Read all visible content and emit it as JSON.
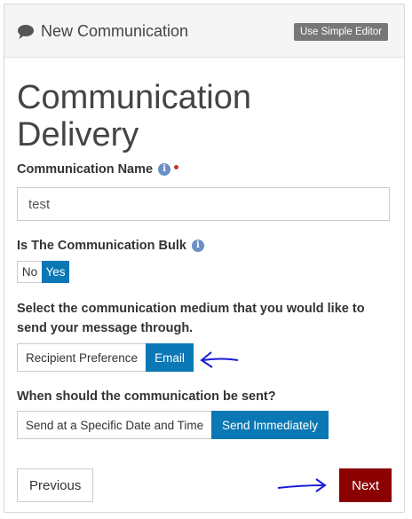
{
  "header": {
    "title": "New Communication",
    "simple_editor_label": "Use Simple Editor"
  },
  "page_title": "Communication Delivery",
  "communication_name": {
    "label": "Communication Name",
    "value": "test"
  },
  "bulk": {
    "label": "Is The Communication Bulk",
    "options": [
      "No",
      "Yes"
    ],
    "selected": "Yes"
  },
  "medium": {
    "label": "Select the communication medium that you would like to send your message through.",
    "options": [
      "Recipient Preference",
      "Email"
    ],
    "selected": "Email"
  },
  "timing": {
    "label": "When should the communication be sent?",
    "options": [
      "Send at a Specific Date and Time",
      "Send Immediately"
    ],
    "selected": "Send Immediately"
  },
  "nav": {
    "previous_label": "Previous",
    "next_label": "Next"
  },
  "colors": {
    "active_toggle": "#0a78b4",
    "next_button": "#8b0000",
    "annotation_arrow": "#1a1ad8"
  }
}
